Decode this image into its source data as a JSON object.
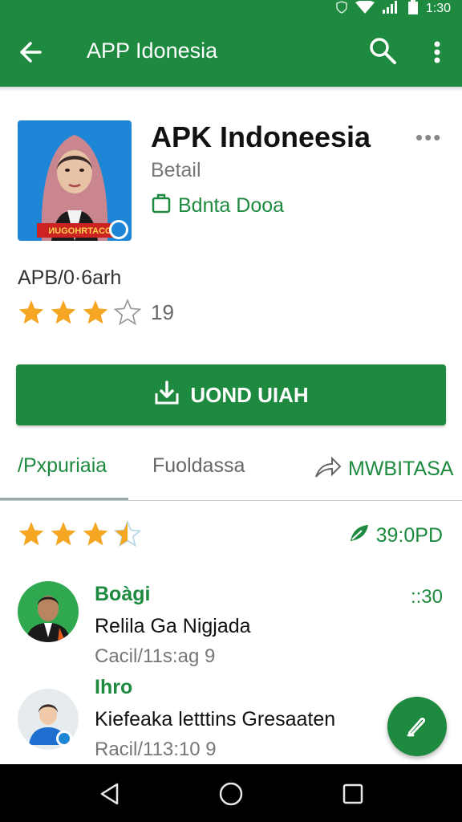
{
  "status_bar": {
    "time": "1:30"
  },
  "app_bar": {
    "title": "APP Idonesia"
  },
  "app": {
    "title": "APK Indoneesia",
    "subtitle": "Betail",
    "developer": "Bdnta Dooa",
    "icon_banner": "ИUGOHRTACG",
    "meta": "APB/0·6arh",
    "rating_stars": 3,
    "rating_count": "19"
  },
  "install_button": {
    "label": "UOND UIAH"
  },
  "tabs": [
    {
      "label": "/Pxpuriaia"
    },
    {
      "label": "Fuoldassa"
    },
    {
      "label": "MWBITASA"
    }
  ],
  "reviews_header": {
    "rating_stars": 3.5,
    "meta": "39:0PD"
  },
  "reviews": [
    {
      "name": "Boàgi",
      "title": "Relila Ga Nigjada",
      "sub": "Cacil/11s:ag   9",
      "time": "::30"
    },
    {
      "name": "Ihro",
      "title": "Kiefeaka letttins Gresaaten",
      "sub": "Racil/113:10   9",
      "time": ""
    }
  ],
  "colors": {
    "primary": "#1e8a3f",
    "star": "#f5a623"
  }
}
